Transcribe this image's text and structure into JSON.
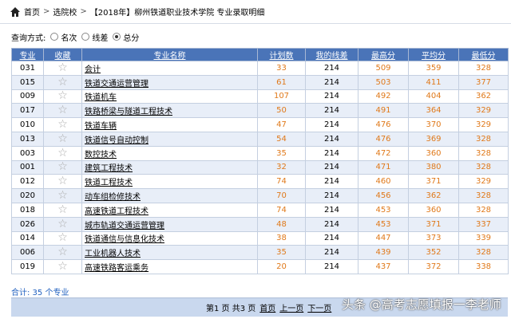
{
  "breadcrumb": {
    "home": "首页",
    "sep1": ">",
    "school_select": "选院校",
    "sep2": ">",
    "title": "【2018年】柳州铁道职业技术学院 专业录取明细"
  },
  "query": {
    "label": "查询方式:",
    "options": [
      "名次",
      "线差",
      "总分"
    ],
    "selected": "总分"
  },
  "table": {
    "headers": [
      "专业",
      "收藏",
      "专业名称",
      "计划数",
      "我的线差",
      "最高分",
      "平均分",
      "最低分"
    ],
    "rows": [
      {
        "code": "031",
        "name": "会计",
        "plan": "33",
        "line": "214",
        "hi": "509",
        "avg": "359",
        "lo": "328"
      },
      {
        "code": "015",
        "name": "铁道交通运营管理",
        "plan": "61",
        "line": "214",
        "hi": "503",
        "avg": "411",
        "lo": "377"
      },
      {
        "code": "009",
        "name": "铁道机车",
        "plan": "107",
        "line": "214",
        "hi": "492",
        "avg": "404",
        "lo": "362"
      },
      {
        "code": "017",
        "name": "铁路桥梁与隧道工程技术",
        "plan": "50",
        "line": "214",
        "hi": "491",
        "avg": "364",
        "lo": "329"
      },
      {
        "code": "010",
        "name": "铁道车辆",
        "plan": "47",
        "line": "214",
        "hi": "476",
        "avg": "370",
        "lo": "329"
      },
      {
        "code": "013",
        "name": "铁道信号自动控制",
        "plan": "54",
        "line": "214",
        "hi": "476",
        "avg": "369",
        "lo": "328"
      },
      {
        "code": "003",
        "name": "数控技术",
        "plan": "35",
        "line": "214",
        "hi": "472",
        "avg": "360",
        "lo": "328"
      },
      {
        "code": "001",
        "name": "建筑工程技术",
        "plan": "32",
        "line": "214",
        "hi": "471",
        "avg": "380",
        "lo": "328"
      },
      {
        "code": "012",
        "name": "铁道工程技术",
        "plan": "74",
        "line": "214",
        "hi": "460",
        "avg": "371",
        "lo": "329"
      },
      {
        "code": "020",
        "name": "动车组检修技术",
        "plan": "70",
        "line": "214",
        "hi": "456",
        "avg": "362",
        "lo": "328"
      },
      {
        "code": "018",
        "name": "高速铁道工程技术",
        "plan": "74",
        "line": "214",
        "hi": "453",
        "avg": "360",
        "lo": "328"
      },
      {
        "code": "026",
        "name": "城市轨道交通运营管理",
        "plan": "48",
        "line": "214",
        "hi": "453",
        "avg": "371",
        "lo": "337"
      },
      {
        "code": "014",
        "name": "铁道通信与信息化技术",
        "plan": "38",
        "line": "214",
        "hi": "447",
        "avg": "373",
        "lo": "339"
      },
      {
        "code": "006",
        "name": "工业机器人技术",
        "plan": "35",
        "line": "214",
        "hi": "439",
        "avg": "352",
        "lo": "328"
      },
      {
        "code": "019",
        "name": "高速铁路客运乘务",
        "plan": "20",
        "line": "214",
        "hi": "437",
        "avg": "372",
        "lo": "338"
      }
    ]
  },
  "summary": "合计: 35 个专业",
  "pager": {
    "page_info": "第1 页 共3 页",
    "first": "首页",
    "prev": "上一页",
    "next": "下一页"
  },
  "watermark": "头条 @高考志愿填报一李老师",
  "colors": {
    "header_bg": "#4a74b8",
    "alt_row_bg": "#e8eef8",
    "score_color": "#e0791a",
    "summary_color": "#1f5fbf",
    "pager_bg": "#c9d8ee"
  },
  "icons": {
    "home": "home-icon",
    "favorite": "star-outline-icon"
  }
}
